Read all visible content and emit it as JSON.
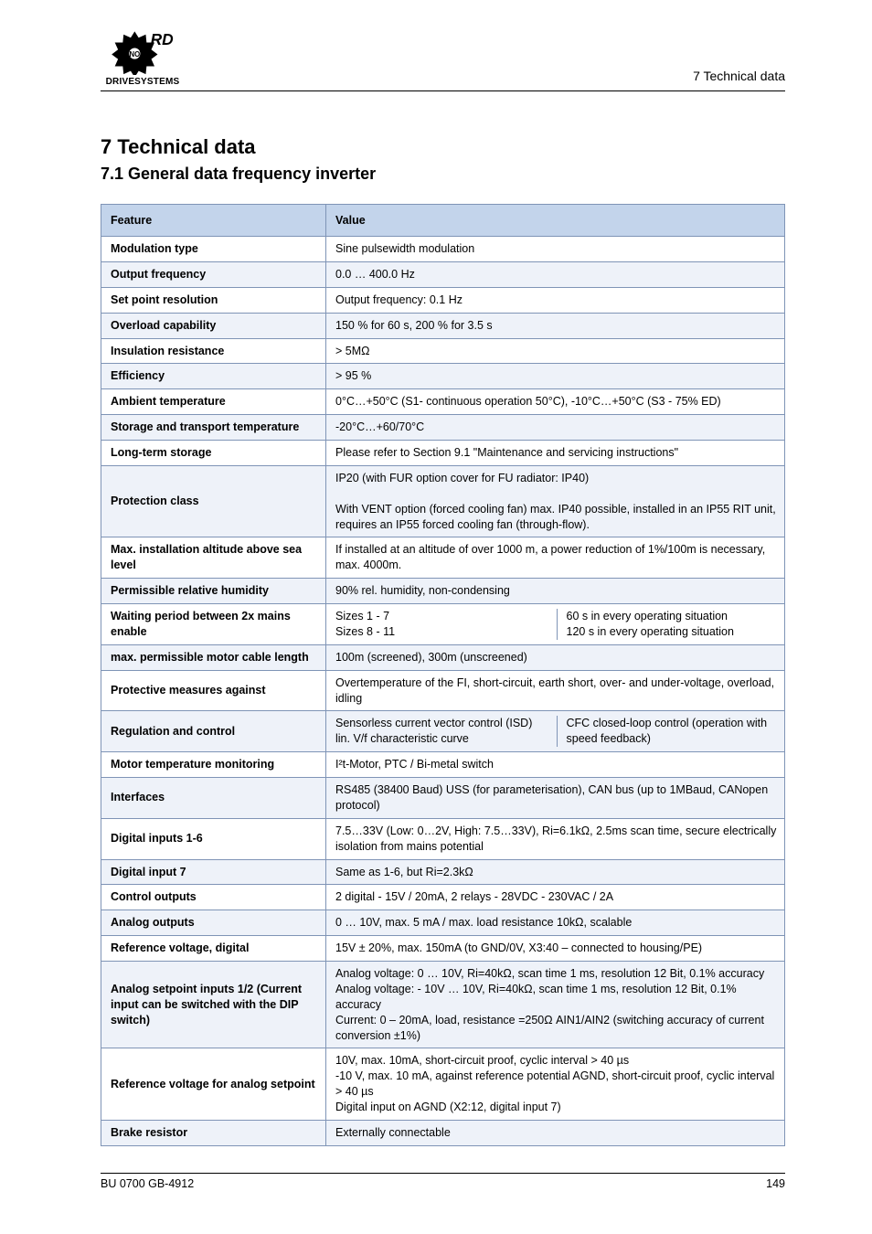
{
  "header": {
    "logo_top": "NORD",
    "logo_bottom": "DRIVESYSTEMS",
    "right": "7 Technical data"
  },
  "sec1": "7 Technical data",
  "sec2": "7.1 General data frequency inverter",
  "thead": {
    "feature": "Feature",
    "value": "Value"
  },
  "rows": [
    {
      "label": "Modulation type",
      "value": "Sine pulsewidth modulation"
    },
    {
      "label": "Output frequency",
      "value": "0.0 … 400.0 Hz"
    },
    {
      "label": "Set point resolution",
      "value": "Output frequency: 0.1 Hz"
    },
    {
      "label": "Overload capability",
      "value": "150 % for 60 s, 200 % for 3.5 s"
    },
    {
      "label": "Insulation resistance",
      "value": "> 5MΩ"
    },
    {
      "label": "Efficiency",
      "value": "> 95 %"
    },
    {
      "label": "Ambient temperature",
      "value": "0°C…+50°C (S1- continuous operation 50°C), -10°C…+50°C (S3 - 75% ED)"
    },
    {
      "label": "Storage and transport temperature",
      "value": "-20°C…+60/70°C"
    },
    {
      "label": "Long-term storage",
      "value": "Please refer to Section 9.1 \"Maintenance and servicing instructions\""
    },
    {
      "label": "Protection class",
      "value": "IP20 (with FUR option cover for FU radiator: IP40)\n\nWith VENT option (forced cooling fan) max. IP40 possible, installed in an IP55 RIT unit, requires an IP55 forced cooling fan (through-flow)."
    },
    {
      "label": "Max. installation altitude above sea level",
      "value": "If installed at an altitude of over 1000 m, a power reduction of 1%/100m is necessary, max. 4000m."
    },
    {
      "label": "Permissible relative humidity",
      "value": "90% rel. humidity, non-condensing"
    },
    {
      "label": "Waiting period between 2x mains enable",
      "split": true,
      "sub": {
        "k": "Sizes 1 - 7\nSizes 8 - 11",
        "v": "60 s in every operating situation\n120 s in every operating situation"
      }
    },
    {
      "label": "max. permissible motor cable length",
      "value": "100m (screened), 300m (unscreened)"
    },
    {
      "label": "Protective measures against",
      "value": "Overtemperature of the FI, short-circuit, earth short, over- and under-voltage, overload, idling"
    },
    {
      "label": "Regulation and control",
      "split": true,
      "sub": {
        "k": "Sensorless current vector control (ISD)\nlin. V/f characteristic curve",
        "v": "CFC closed-loop control (operation with speed feedback)"
      }
    },
    {
      "label": "Motor temperature monitoring",
      "value": "I²t-Motor, PTC / Bi-metal switch"
    },
    {
      "label": "Interfaces",
      "value": "RS485 (38400 Baud) USS (for parameterisation), CAN bus (up to 1MBaud, CANopen protocol)"
    },
    {
      "label": "Digital inputs 1-6",
      "value": "7.5…33V (Low: 0…2V, High: 7.5…33V), Ri=6.1kΩ, 2.5ms scan time, secure electrically isolation from mains potential"
    },
    {
      "label": "Digital input 7",
      "value": "Same as 1-6, but Ri=2.3kΩ"
    },
    {
      "label": "Control outputs",
      "value": "2 digital - 15V / 20mA, 2 relays - 28VDC - 230VAC / 2A"
    },
    {
      "label": "Analog outputs",
      "value": "0 … 10V, max. 5 mA / max. load resistance 10kΩ, scalable"
    },
    {
      "label": "Reference voltage, digital",
      "value": "15V ± 20%, max. 150mA (to GND/0V, X3:40 – connected to housing/PE)"
    },
    {
      "label": "Analog setpoint inputs 1/2 (Current input can be switched with the DIP switch)",
      "value": "Analog voltage: 0 … 10V, Ri=40kΩ, scan time 1 ms, resolution 12 Bit, 0.1% accuracy\nAnalog voltage: - 10V … 10V, Ri=40kΩ, scan time 1 ms, resolution 12 Bit, 0.1% accuracy\nCurrent: 0 – 20mA, load, resistance =250Ω AIN1/AIN2 (switching accuracy of current conversion ±1%)"
    },
    {
      "label": "Reference voltage for analog setpoint",
      "value": "10V, max. 10mA, short-circuit proof, cyclic interval > 40 µs\n-10 V, max. 10 mA, against reference potential AGND, short-circuit proof, cyclic interval > 40 µs\nDigital input on AGND (X2:12, digital input 7)"
    },
    {
      "label": "Brake resistor",
      "value": "Externally connectable"
    }
  ],
  "footer": {
    "left": "BU 0700 GB-4912",
    "right": "149"
  }
}
